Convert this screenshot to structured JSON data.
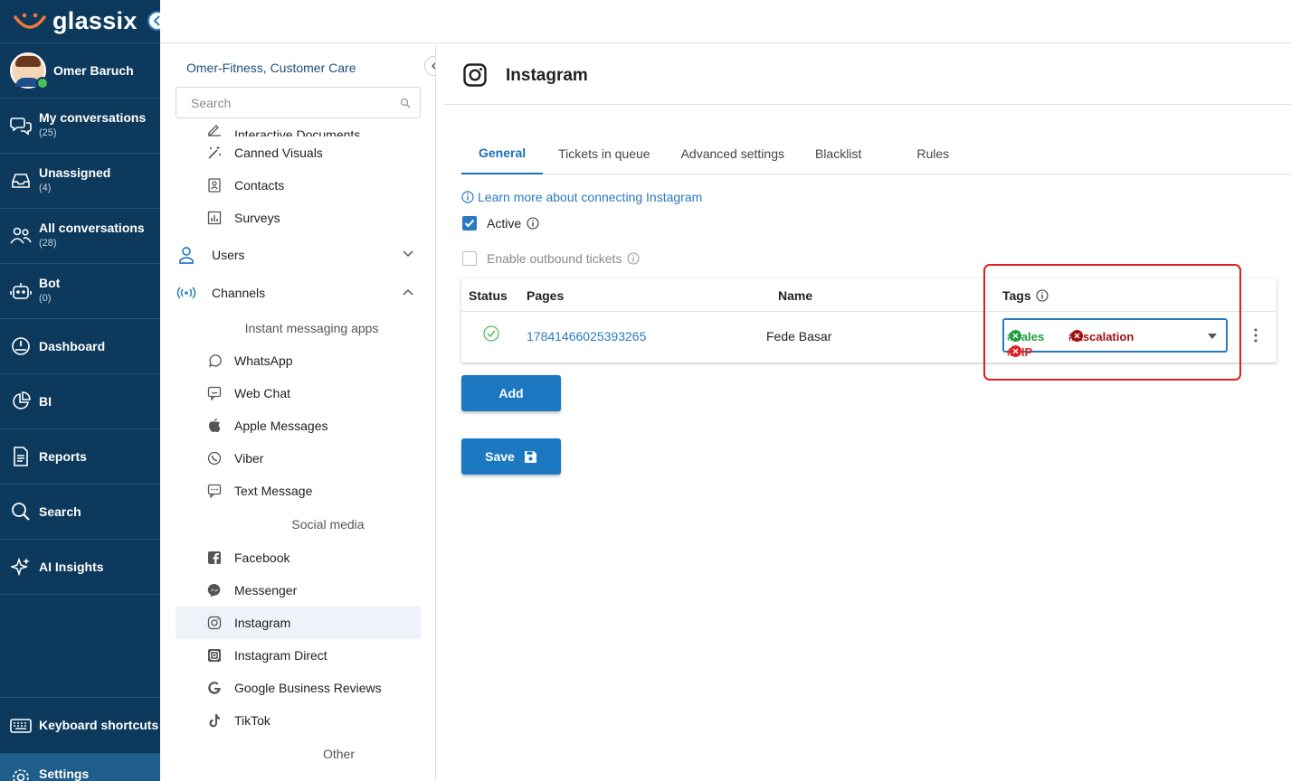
{
  "app": {
    "brand": "glassix"
  },
  "user": {
    "name": "Omer Baruch"
  },
  "nav": {
    "items": [
      {
        "label": "My conversations",
        "count": "(25)",
        "icon": "chat-bubbles-icon"
      },
      {
        "label": "Unassigned",
        "count": "(4)",
        "icon": "inbox-icon"
      },
      {
        "label": "All conversations",
        "count": "(28)",
        "icon": "users-group-icon"
      },
      {
        "label": "Bot",
        "count": "(0)",
        "icon": "robot-icon"
      },
      {
        "label": "Dashboard",
        "icon": "gauge-icon"
      },
      {
        "label": "BI",
        "icon": "pie-chart-icon"
      },
      {
        "label": "Reports",
        "icon": "report-icon"
      },
      {
        "label": "Search",
        "icon": "search-icon"
      },
      {
        "label": "AI Insights",
        "icon": "sparkle-icon"
      }
    ],
    "bottom": [
      {
        "label": "Keyboard shortcuts",
        "icon": "keyboard-icon"
      },
      {
        "label": "Settings",
        "icon": "gear-icon"
      }
    ]
  },
  "menu": {
    "org": "Omer-Fitness, Customer Care",
    "search_placeholder": "Search",
    "items": {
      "interactive_documents": "Interactive Documents",
      "canned_visuals": "Canned Visuals",
      "contacts": "Contacts",
      "surveys": "Surveys",
      "users": "Users",
      "channels": "Channels",
      "instant_messaging": "Instant messaging apps",
      "whatsapp": "WhatsApp",
      "web_chat": "Web Chat",
      "apple_messages": "Apple Messages",
      "viber": "Viber",
      "text_message": "Text Message",
      "social_media": "Social media",
      "facebook": "Facebook",
      "messenger": "Messenger",
      "instagram": "Instagram",
      "instagram_direct": "Instagram Direct",
      "google_reviews": "Google Business Reviews",
      "tiktok": "TikTok",
      "other": "Other"
    }
  },
  "main": {
    "title": "Instagram",
    "tabs": [
      "General",
      "Tickets in queue",
      "Advanced settings",
      "Blacklist",
      "Rules"
    ],
    "learn_more": "Learn more about connecting Instagram",
    "active_label": "Active",
    "active_checked": true,
    "outbound_label": "Enable outbound tickets",
    "outbound_checked": false,
    "grid": {
      "headers": {
        "status": "Status",
        "pages": "Pages",
        "name": "Name",
        "tags": "Tags"
      },
      "row": {
        "status": "active",
        "page_id": "17841466025393265",
        "name": "Fede Basar",
        "tags": [
          {
            "label": "#Sales",
            "color": "#1e9e3e"
          },
          {
            "label": "#Escalation",
            "color": "#a01010"
          },
          {
            "label": "#VIP",
            "color": "#e02020"
          }
        ]
      }
    },
    "add_label": "Add",
    "save_label": "Save"
  },
  "colors": {
    "nav_bg": "#0d3a5c",
    "accent": "#1d78c2",
    "highlight_frame": "#e02020"
  }
}
